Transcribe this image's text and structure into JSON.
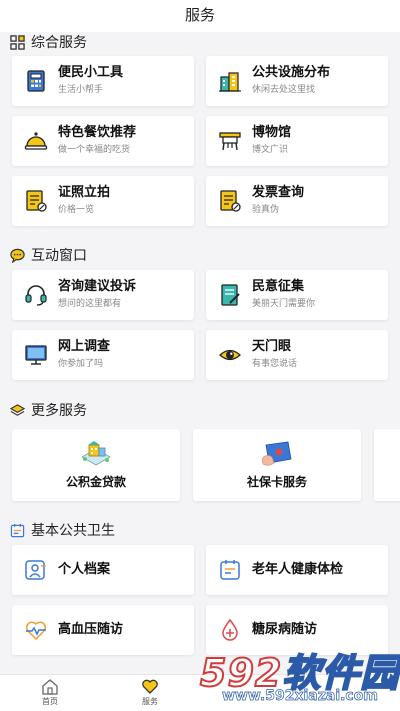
{
  "header": {
    "title": "服务"
  },
  "sections": {
    "comprehensive": {
      "title": "综合服务",
      "items": [
        {
          "title": "便民小工具",
          "subtitle": "生活小帮手",
          "icon": "calculator-icon"
        },
        {
          "title": "公共设施分布",
          "subtitle": "休闲去处这里找",
          "icon": "facility-building-icon"
        },
        {
          "title": "特色餐饮推荐",
          "subtitle": "做一个幸福的吃货",
          "icon": "dining-cloche-icon"
        },
        {
          "title": "博物馆",
          "subtitle": "博文广识",
          "icon": "museum-icon"
        },
        {
          "title": "证照立拍",
          "subtitle": "价格一览",
          "icon": "document-stamp-icon"
        },
        {
          "title": "发票查询",
          "subtitle": "验真伪",
          "icon": "invoice-icon"
        }
      ]
    },
    "interactive": {
      "title": "互动窗口",
      "items": [
        {
          "title": "咨询建议投诉",
          "subtitle": "想问的这里都有",
          "icon": "headset-icon"
        },
        {
          "title": "民意征集",
          "subtitle": "美丽天门需要你",
          "icon": "notebook-pen-icon"
        },
        {
          "title": "网上调查",
          "subtitle": "你参加了吗",
          "icon": "monitor-icon"
        },
        {
          "title": "天门眼",
          "subtitle": "有事您说话",
          "icon": "eye-icon"
        }
      ]
    },
    "more": {
      "title": "更多服务",
      "items": [
        {
          "title": "公积金贷款",
          "icon": "housing-fund-icon"
        },
        {
          "title": "社保卡服务",
          "icon": "social-security-card-icon"
        }
      ]
    },
    "health": {
      "title": "基本公共卫生",
      "items": [
        {
          "title": "个人档案",
          "icon": "personal-file-icon"
        },
        {
          "title": "老年人健康体检",
          "icon": "calendar-checkup-icon"
        },
        {
          "title": "高血压随访",
          "icon": "heartbeat-icon"
        },
        {
          "title": "糖尿病随访",
          "icon": "blood-drop-icon"
        }
      ]
    }
  },
  "tabbar": {
    "items": [
      {
        "label": "首页",
        "icon": "home-icon"
      },
      {
        "label": "服务",
        "icon": "heart-icon"
      }
    ]
  },
  "watermark": {
    "brand_number": "592",
    "brand_text": "软件园",
    "url": "www.592xiazai.com"
  },
  "colors": {
    "accent_yellow": "#f5c518",
    "accent_blue": "#3a78d8",
    "icon_orange": "#f0a030",
    "icon_red": "#e04848",
    "watermark_blue": "#2a5aa8",
    "watermark_red": "#d23b3b"
  }
}
